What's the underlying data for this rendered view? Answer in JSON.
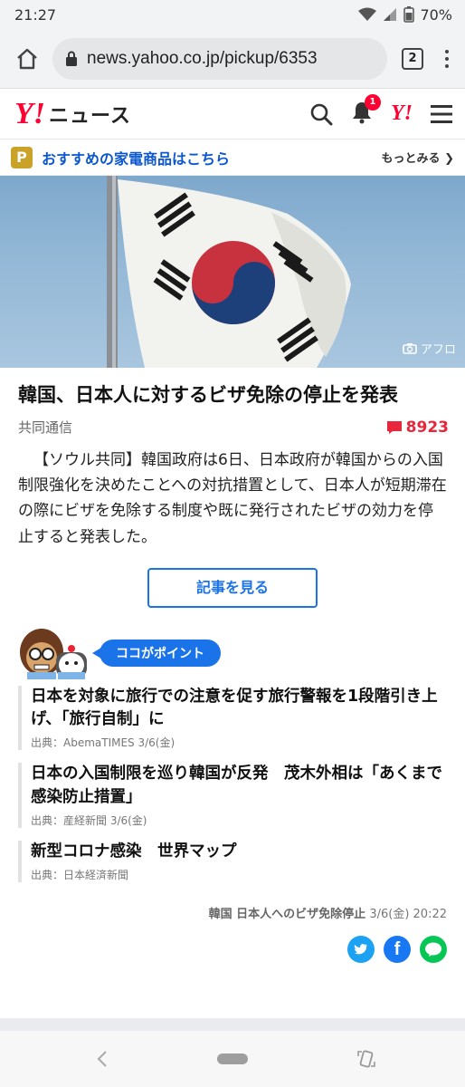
{
  "status_bar": {
    "time": "21:27",
    "battery": "70%"
  },
  "browser": {
    "url": "news.yahoo.co.jp/pickup/6353",
    "tab_count": "2"
  },
  "header": {
    "logo_mark": "Y!",
    "logo_text": "ニュース",
    "notification_count": "1",
    "mini_logo": "Y!"
  },
  "promo": {
    "text": "おすすめの家電商品はこちら",
    "more": "もっとみる"
  },
  "hero": {
    "credit": "アフロ"
  },
  "article": {
    "title": "韓国、日本人に対するビザ免除の停止を発表",
    "source": "共同通信",
    "comment_count": "8923",
    "body": "【ソウル共同】韓国政府は6日、日本政府が韓国からの入国制限強化を決めたことへの対抗措置として、日本人が短期滞在の際にビザを免除する制度や既に発行されたビザの効力を停止すると発表した。",
    "read_button": "記事を見る"
  },
  "point": {
    "label": "ココがポイント",
    "items": [
      {
        "title": "日本を対象に旅行での注意を促す旅行警報を1段階引き上げ、「旅行自制」に",
        "source": "出典：AbemaTIMES 3/6(金)"
      },
      {
        "title": "日本の入国制限を巡り韓国が反発　茂木外相は「あくまで感染防止措置」",
        "source": "出典：産経新聞 3/6(金)"
      },
      {
        "title": "新型コロナ感染　世界マップ",
        "source": "出典：日本経済新聞"
      }
    ]
  },
  "footer": {
    "topic": "韓国 日本人へのビザ免除停止",
    "datetime": "3/6(金) 20:22"
  },
  "colors": {
    "accent": "#1a73e8",
    "brand_red": "#ff0033",
    "comment_red": "#e8263c"
  }
}
